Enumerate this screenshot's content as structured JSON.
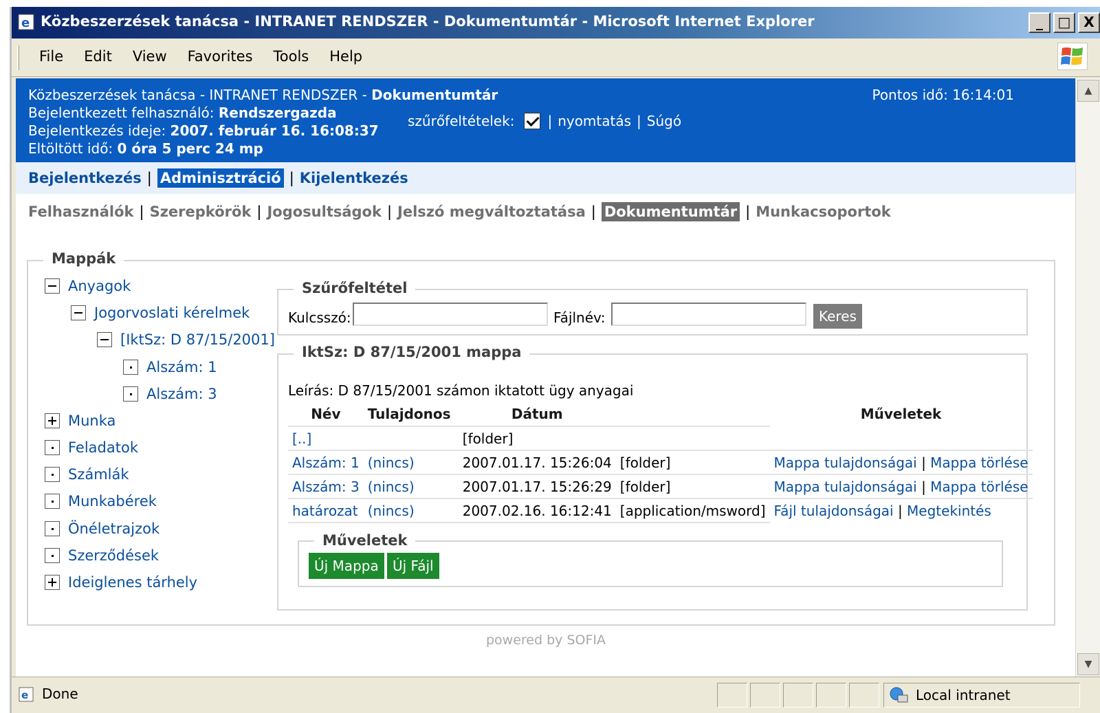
{
  "window": {
    "title": "Közbeszerzések tanácsa - INTRANET RENDSZER - Dokumentumtár - Microsoft Internet Explorer",
    "min": "_",
    "max": "□",
    "close": "X"
  },
  "menu": {
    "items": [
      "File",
      "Edit",
      "View",
      "Favorites",
      "Tools",
      "Help"
    ]
  },
  "header": {
    "line1_prefix": "Közbeszerzések tanácsa - INTRANET RENDSZER - ",
    "line1_bold": "Dokumentumtár",
    "user_label": "Bejelentkezett felhasználó: ",
    "user_value": "Rendszergazda",
    "login_label": "Bejelentkezés ideje: ",
    "login_value": "2007. február 16. 16:08:37",
    "elapsed_label": "Eltöltött idő: ",
    "elapsed_value": "0 óra 5 perc 24 mp",
    "clock": "Pontos idő: 16:14:01",
    "filter_label": "szűrőfeltételek:",
    "print_link": "nyomtatás",
    "help_link": "Súgó",
    "pipe": "|"
  },
  "nav1": {
    "items": [
      "Bejelentkezés",
      "Adminisztráció",
      "Kijelentkezés"
    ],
    "active": "Adminisztráció"
  },
  "nav2": {
    "items": [
      "Felhasználók",
      "Szerepkörök",
      "Jogosultságok",
      "Jelszó megváltoztatása",
      "Dokumentumtár",
      "Munkacsoportok"
    ],
    "active": "Dokumentumtár"
  },
  "folders": {
    "legend": "Mappák",
    "tree": [
      {
        "label": "Anyagok"
      },
      {
        "label": "Jogorvoslati kérelmek"
      },
      {
        "label": "[IktSz: D 87/15/2001]"
      },
      {
        "label": "Alszám: 1"
      },
      {
        "label": "Alszám: 3"
      },
      {
        "label": "Munka"
      },
      {
        "label": "Feladatok"
      },
      {
        "label": "Számlák"
      },
      {
        "label": "Munkabérek"
      },
      {
        "label": "Önéletrajzok"
      },
      {
        "label": "Szerződések"
      },
      {
        "label": "Ideiglenes tárhely"
      }
    ]
  },
  "filter": {
    "legend": "Szűrőfeltétel",
    "keyword_label": "Kulcsszó:",
    "keyword_value": "",
    "filename_label": "Fájlnév:",
    "filename_value": "",
    "search_button": "Keres"
  },
  "folder_view": {
    "legend": "IktSz: D 87/15/2001 mappa",
    "description": "Leírás: D 87/15/2001 számon iktatott ügy anyagai",
    "columns": [
      "Név",
      "Tulajdonos",
      "Dátum",
      "",
      "Műveletek"
    ],
    "rows": [
      {
        "name": "[..]",
        "owner": "",
        "date": "[folder]",
        "type": "",
        "op1": "",
        "op2": ""
      },
      {
        "name": "Alszám: 1",
        "owner": "(nincs)",
        "date": "2007.01.17. 15:26:04",
        "type": "[folder]",
        "op1": "Mappa tulajdonságai",
        "op2": "Mappa törlése"
      },
      {
        "name": "Alszám: 3",
        "owner": "(nincs)",
        "date": "2007.01.17. 15:26:29",
        "type": "[folder]",
        "op1": "Mappa tulajdonságai",
        "op2": "Mappa törlése"
      },
      {
        "name": "határozat",
        "owner": "(nincs)",
        "date": "2007.02.16. 16:12:41",
        "type": "[application/msword]",
        "op1": "Fájl tulajdonságai",
        "op2": "Megtekintés"
      }
    ],
    "ops_legend": "Műveletek",
    "new_folder": "Új Mappa",
    "new_file": "Új Fájl"
  },
  "footer": {
    "powered": "powered by SOFIA"
  },
  "statusbar": {
    "status": "Done",
    "zone": "Local intranet"
  },
  "colors": {
    "header_bg": "#0a5cc0",
    "link": "#0b4f9c",
    "green_button": "#1d8a2e"
  }
}
